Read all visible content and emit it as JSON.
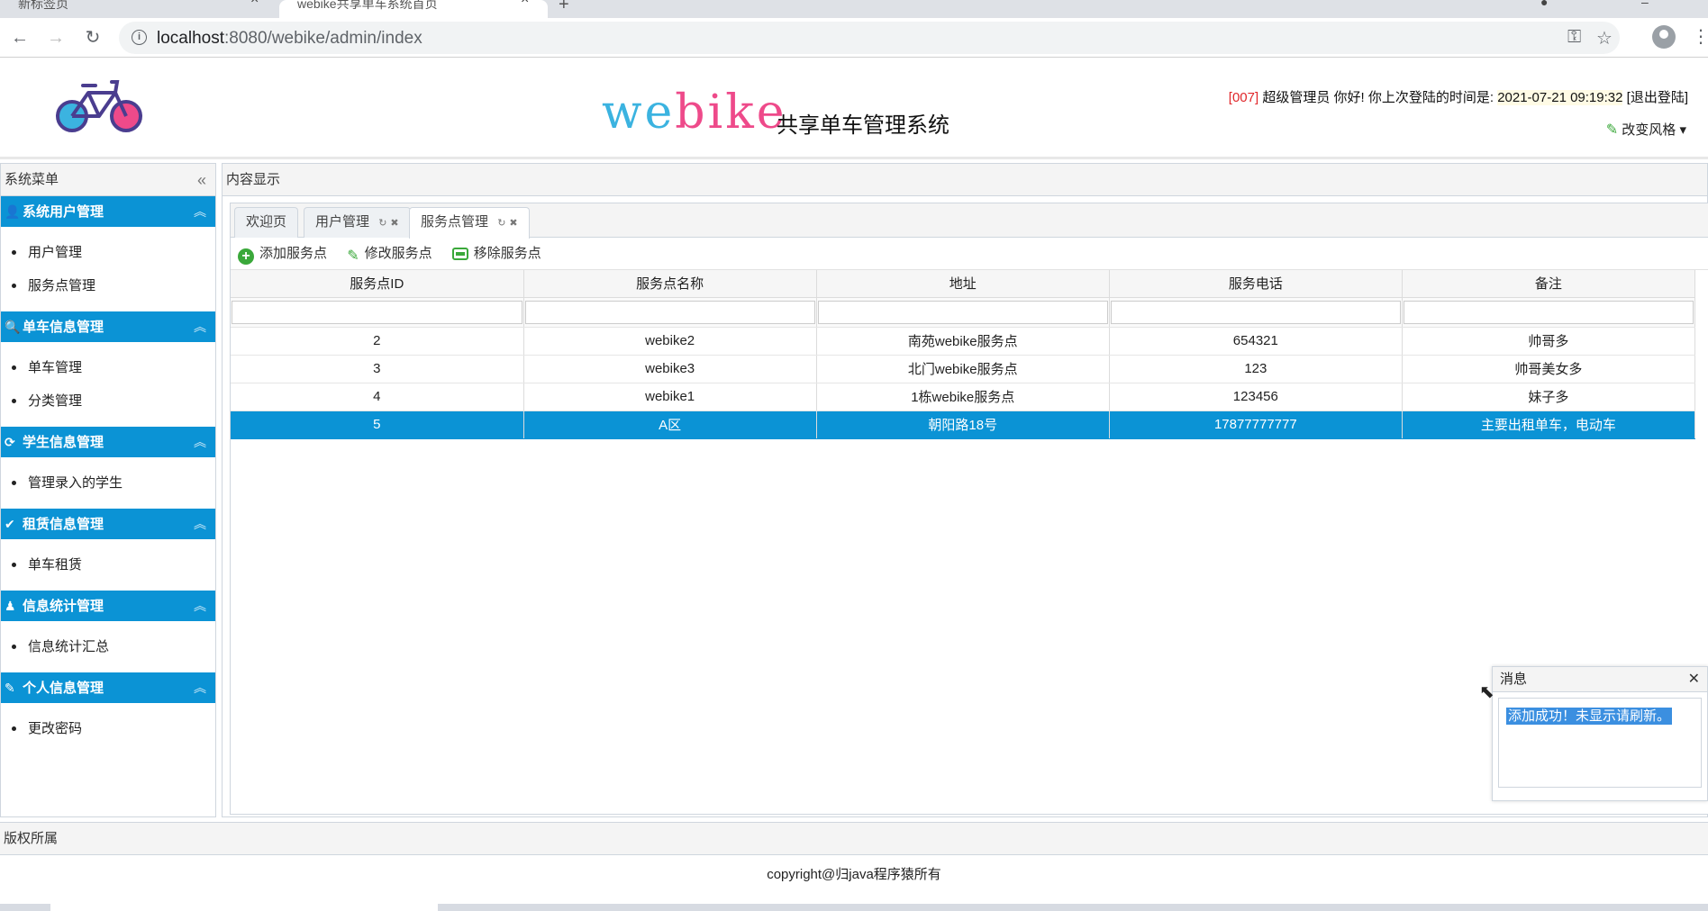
{
  "browser": {
    "tabs": [
      {
        "label": "新标签页",
        "active": false
      },
      {
        "label": "webike共享单车系统首页",
        "active": true
      }
    ],
    "url_host": "localhost",
    "url_rest": ":8080/webike/admin/index"
  },
  "header": {
    "brand_part1": "we",
    "brand_part2": "bike",
    "brand_sub": "共享单车管理系统",
    "user_id": "[007]",
    "user_greeting": "超级管理员 你好! 你上次登陆的时间是:",
    "last_login": "2021-07-21 09:19:32",
    "logout": "[退出登陆]",
    "change_style": "改变风格"
  },
  "sidebar": {
    "title": "系统菜单",
    "groups": [
      {
        "title": "系统用户管理",
        "icon": "user-icon",
        "items": [
          "用户管理",
          "服务点管理"
        ]
      },
      {
        "title": "单车信息管理",
        "icon": "search-icon",
        "items": [
          "单车管理",
          "分类管理"
        ]
      },
      {
        "title": "学生信息管理",
        "icon": "refresh-icon",
        "items": [
          "管理录入的学生"
        ]
      },
      {
        "title": "租赁信息管理",
        "icon": "check-icon",
        "items": [
          "单车租赁"
        ]
      },
      {
        "title": "信息统计管理",
        "icon": "stats-icon",
        "items": [
          "信息统计汇总"
        ]
      },
      {
        "title": "个人信息管理",
        "icon": "pencil-icon",
        "items": [
          "更改密码"
        ]
      }
    ]
  },
  "content": {
    "title": "内容显示",
    "tabs": [
      "欢迎页",
      "用户管理",
      "服务点管理"
    ],
    "active_tab": "服务点管理",
    "toolbar": {
      "add": "添加服务点",
      "edit": "修改服务点",
      "remove": "移除服务点"
    },
    "table": {
      "columns": [
        "服务点ID",
        "服务点名称",
        "地址",
        "服务电话",
        "备注"
      ],
      "rows": [
        [
          "2",
          "webike2",
          "南苑webike服务点",
          "654321",
          "帅哥多"
        ],
        [
          "3",
          "webike3",
          "北门webike服务点",
          "123",
          "帅哥美女多"
        ],
        [
          "4",
          "webike1",
          "1栋webike服务点",
          "123456",
          "妹子多"
        ],
        [
          "5",
          "A区",
          "朝阳路18号",
          "17877777777",
          "主要出租单车，电动车"
        ]
      ],
      "selected_row": 3
    }
  },
  "message": {
    "title": "消息",
    "text": "添加成功！未显示请刷新。"
  },
  "footer": {
    "title": "版权所属",
    "copyright": "copyright@归java程序猿所有"
  },
  "colors": {
    "accent": "#0b93d5",
    "brand_blue": "#3bb3e0",
    "brand_pink": "#ee4a8a",
    "user_id_red": "#e0262a"
  }
}
